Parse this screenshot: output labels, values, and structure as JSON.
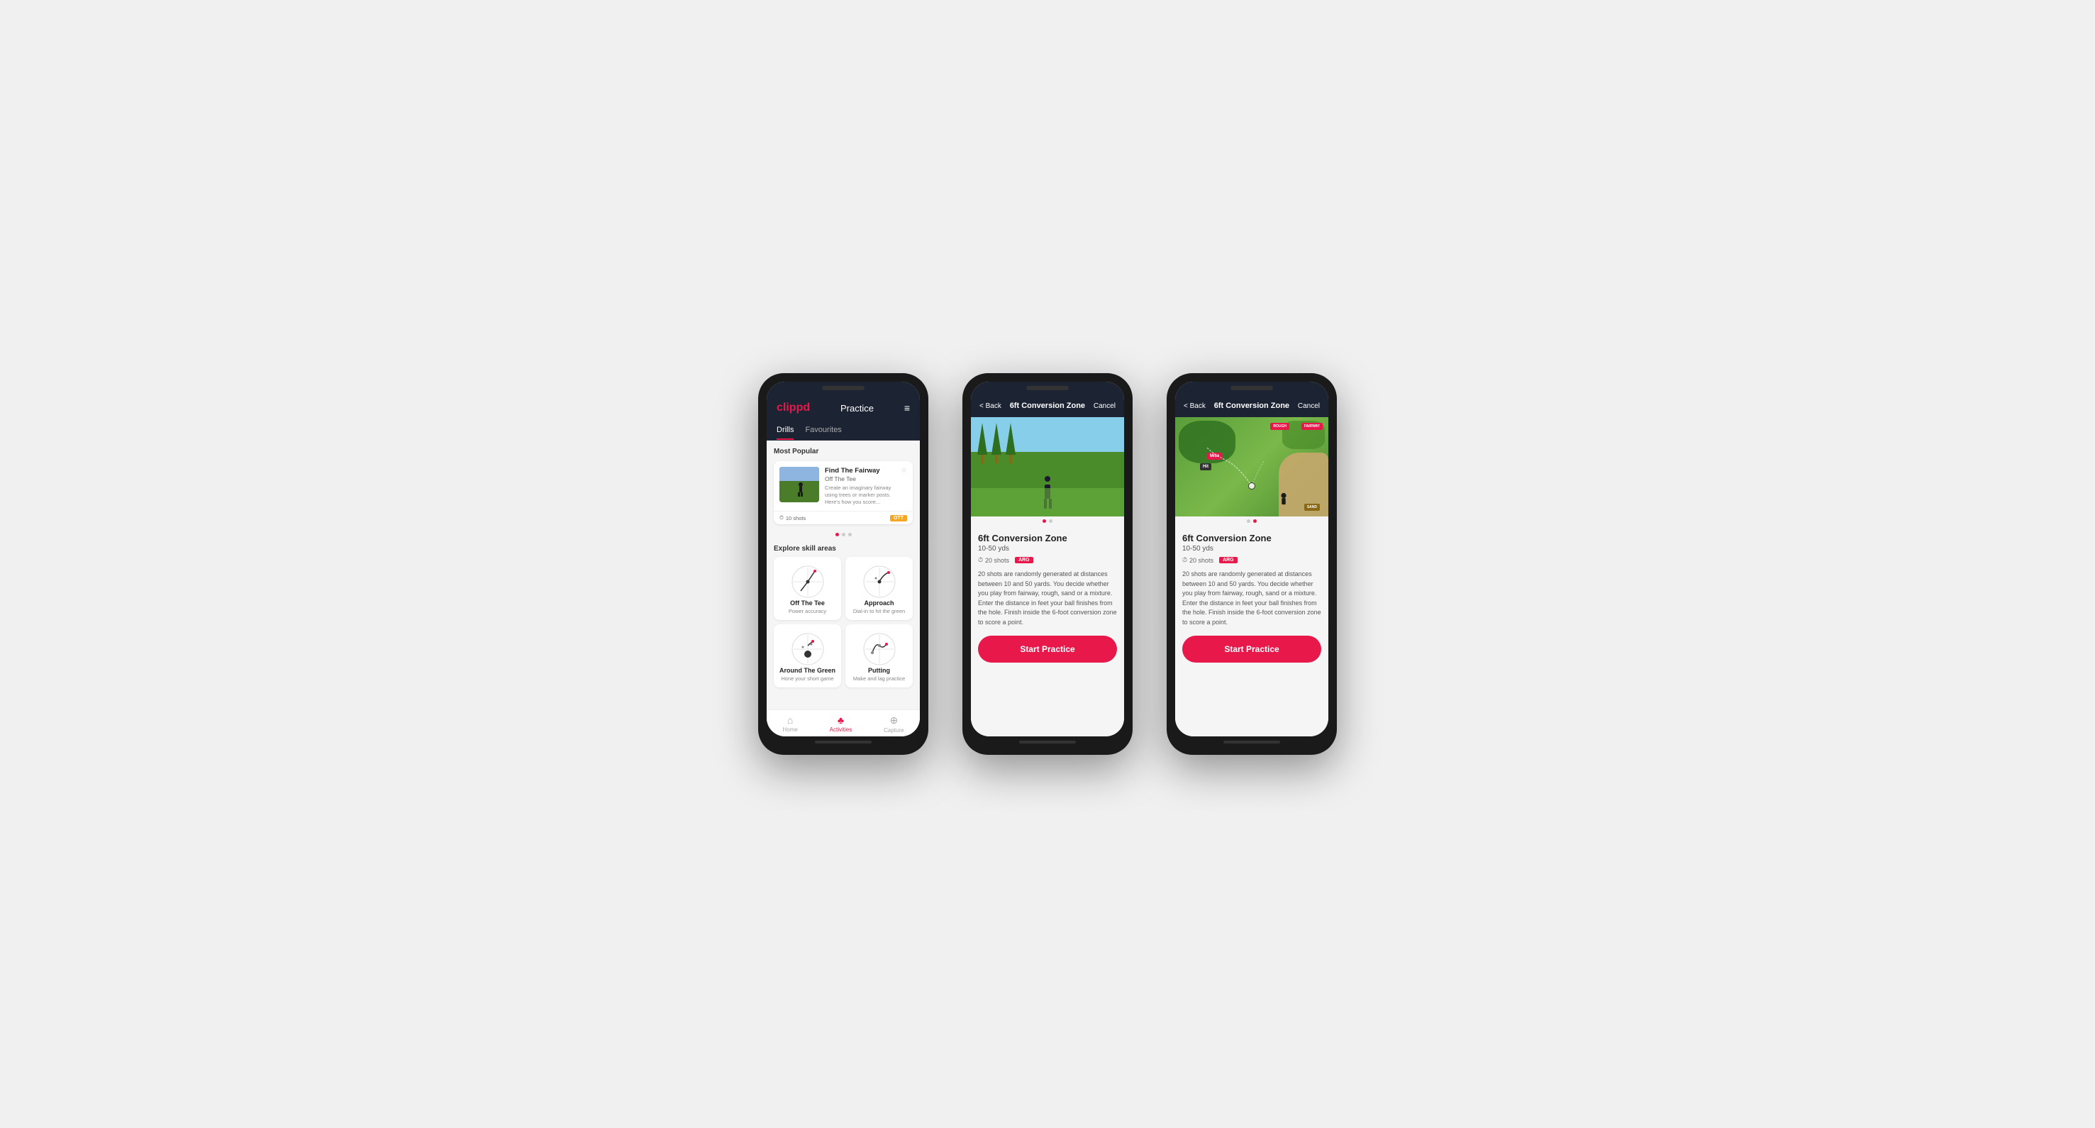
{
  "app": {
    "logo": "clippd",
    "header_title": "Practice",
    "menu_icon": "≡"
  },
  "screen1": {
    "tabs": [
      {
        "label": "Drills",
        "active": true
      },
      {
        "label": "Favourites",
        "active": false
      }
    ],
    "most_popular_label": "Most Popular",
    "featured_drill": {
      "name": "Find The Fairway",
      "sub": "Off The Tee",
      "description": "Create an imaginary fairway using trees or marker posts. Here's how you score...",
      "shots": "10 shots",
      "badge": "OTT"
    },
    "explore_label": "Explore skill areas",
    "skills": [
      {
        "name": "Off The Tee",
        "desc": "Power accuracy"
      },
      {
        "name": "Approach",
        "desc": "Dial-in to hit the green"
      },
      {
        "name": "Around The Green",
        "desc": "Hone your short game"
      },
      {
        "name": "Putting",
        "desc": "Make and lag practice"
      }
    ]
  },
  "screen2": {
    "back_label": "< Back",
    "title": "6ft Conversion Zone",
    "cancel_label": "Cancel",
    "drill_title": "6ft Conversion Zone",
    "drill_range": "10-50 yds",
    "shots": "20 shots",
    "badge": "ARG",
    "description": "20 shots are randomly generated at distances between 10 and 50 yards. You decide whether you play from fairway, rough, sand or a mixture. Enter the distance in feet your ball finishes from the hole. Finish inside the 6-foot conversion zone to score a point.",
    "start_label": "Start Practice"
  },
  "screen3": {
    "back_label": "< Back",
    "title": "6ft Conversion Zone",
    "cancel_label": "Cancel",
    "drill_title": "6ft Conversion Zone",
    "drill_range": "10-50 yds",
    "shots": "20 shots",
    "badge": "ARG",
    "description": "20 shots are randomly generated at distances between 10 and 50 yards. You decide whether you play from fairway, rough, sand or a mixture. Enter the distance in feet your ball finishes from the hole. Finish inside the 6-foot conversion zone to score a point.",
    "start_label": "Start Practice",
    "map_labels": {
      "fairway": "FAIRWAY",
      "rough": "ROUGH",
      "miss": "Miss",
      "hit": "Hit",
      "sand": "SAND"
    }
  },
  "nav": {
    "items": [
      {
        "label": "Home",
        "icon": "⌂",
        "active": false
      },
      {
        "label": "Activities",
        "icon": "♣",
        "active": true
      },
      {
        "label": "Capture",
        "icon": "⊕",
        "active": false
      }
    ]
  }
}
